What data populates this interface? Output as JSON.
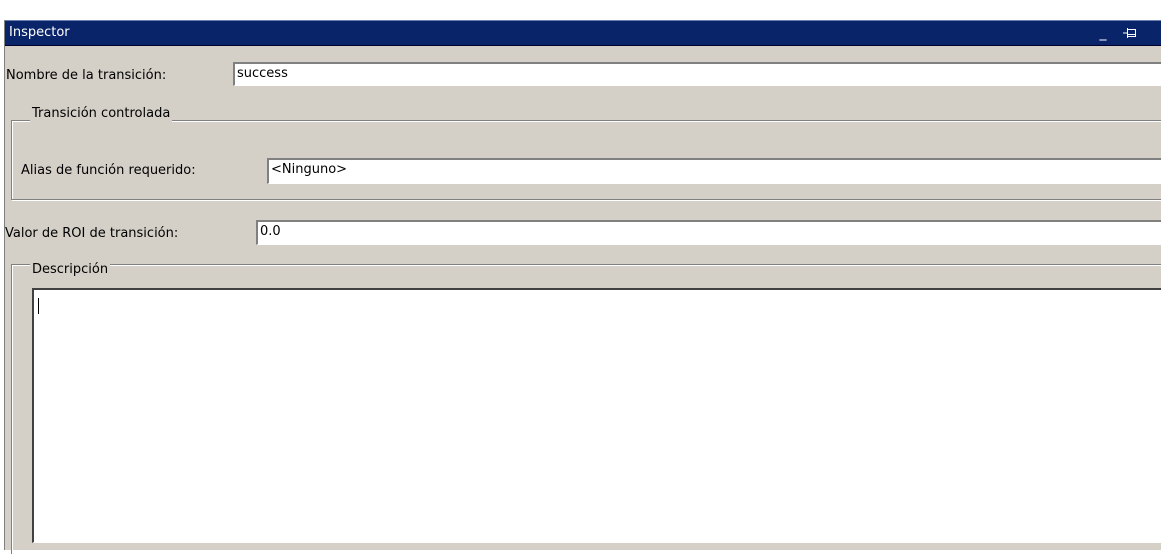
{
  "panel": {
    "title": "Inspector",
    "minimize_glyph": "_",
    "pin_icon": "pin-icon"
  },
  "transition_name": {
    "label": "Nombre de la transición:",
    "value": "success"
  },
  "controlled_group": {
    "legend": "Transición controlada",
    "function_alias_label": "Alias de función requerido:",
    "function_alias_value": "<Ninguno>"
  },
  "roi": {
    "label": "Valor de ROI de transición:",
    "value": "0.0"
  },
  "description_group": {
    "legend": "Descripción",
    "value": ""
  },
  "colors": {
    "titlebar": "#0a246a",
    "panel_bg": "#d4d0c8",
    "field_bg": "#ffffff"
  }
}
